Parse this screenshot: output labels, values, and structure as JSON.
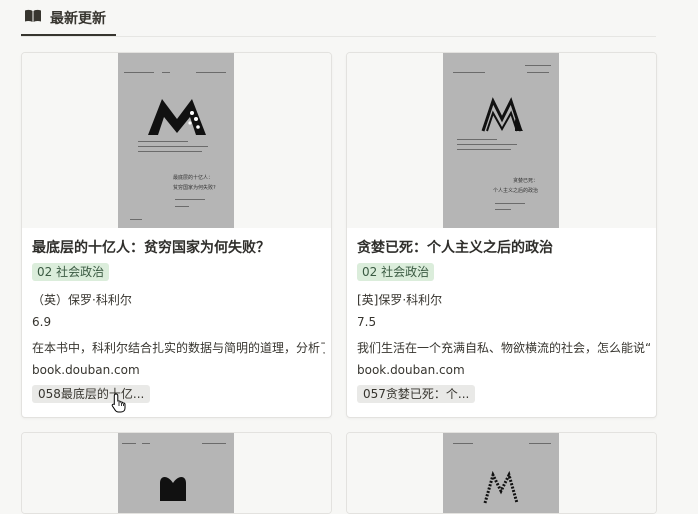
{
  "header": {
    "tab_label": "最新更新",
    "tab_icon": "book-open-icon"
  },
  "cards": [
    {
      "title": "最底层的十亿人：贫穷国家为何失败？",
      "tag": "02 社会政治",
      "author": "（英）保罗·科利尔",
      "rating": "6.9",
      "summary": "在本书中，科利尔结合扎实的数据与简明的道理，分析了",
      "source": "book.douban.com",
      "relation": "058最底层的十亿...",
      "cover": {
        "title": "最底层的十亿人：",
        "subtitle": "贫穷国家为何失败?"
      }
    },
    {
      "title": "贪婪已死：个人主义之后的政治",
      "tag": "02 社会政治",
      "author": "[英]保罗·科利尔",
      "rating": "7.5",
      "summary": "我们生活在一个充满自私、物欲横流的社会，怎么能说“贪",
      "source": "book.douban.com",
      "relation": "057贪婪已死：个...",
      "cover": {
        "title": "贪婪已死：",
        "subtitle": "个人主义之后的政治"
      }
    }
  ],
  "colors": {
    "tag_bg": "#dbeddb",
    "tag_text": "#3a5a42",
    "chip_bg": "#e9e9e7"
  }
}
